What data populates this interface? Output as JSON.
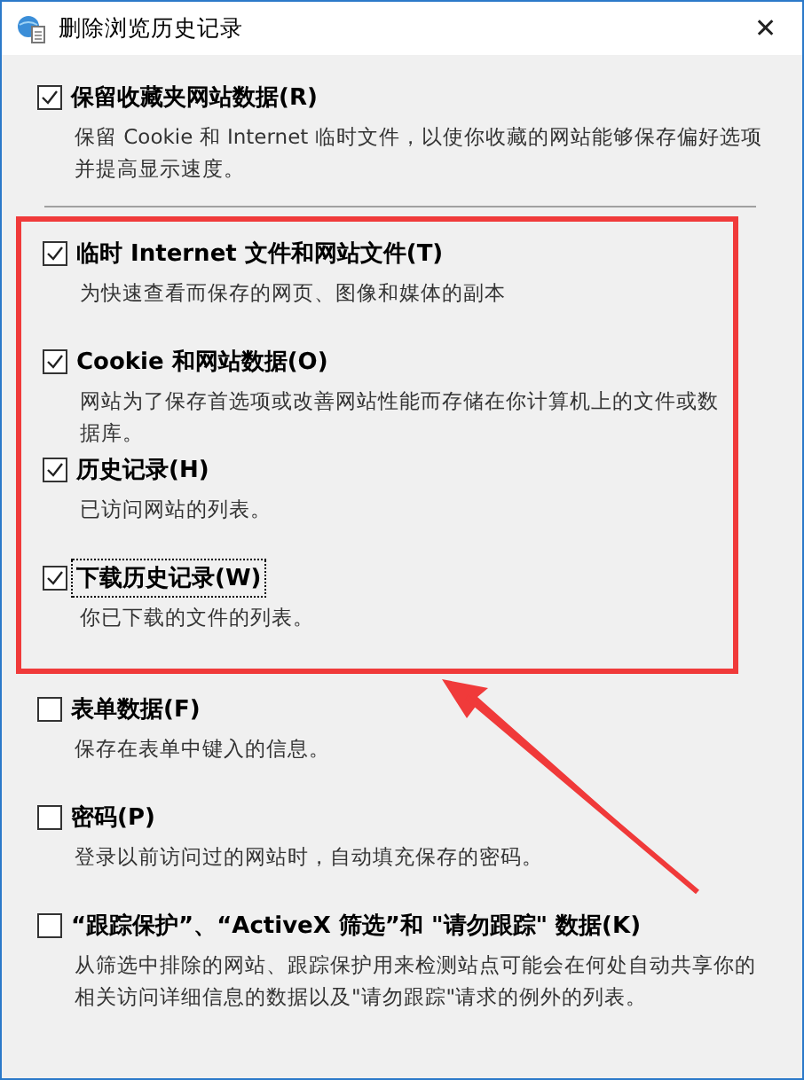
{
  "window": {
    "title": "删除浏览历史记录",
    "close": "✕"
  },
  "options": [
    {
      "label": "保留收藏夹网站数据(R)",
      "description": "保留 Cookie 和 Internet 临时文件，以使你收藏的网站能够保存偏好选项并提高显示速度。",
      "checked": true,
      "focused": false
    },
    {
      "label": "临时 Internet 文件和网站文件(T)",
      "description": "为快速查看而保存的网页、图像和媒体的副本",
      "checked": true,
      "highlighted": true,
      "focused": false
    },
    {
      "label": "Cookie 和网站数据(O)",
      "description": "网站为了保存首选项或改善网站性能而存储在你计算机上的文件或数据库。",
      "checked": true,
      "highlighted": true,
      "focused": false
    },
    {
      "label": "历史记录(H)",
      "description": "已访问网站的列表。",
      "checked": true,
      "highlighted": true,
      "focused": false
    },
    {
      "label": "下载历史记录(W)",
      "description": "你已下载的文件的列表。",
      "checked": true,
      "highlighted": true,
      "focused": true
    },
    {
      "label": "表单数据(F)",
      "description": "保存在表单中键入的信息。",
      "checked": false,
      "highlighted": false,
      "focused": false
    },
    {
      "label": "密码(P)",
      "description": "登录以前访问过的网站时，自动填充保存的密码。",
      "checked": false,
      "highlighted": false,
      "focused": false
    },
    {
      "label": "“跟踪保护”、“ActiveX 筛选”和 \"请勿跟踪\" 数据(K)",
      "description": "从筛选中排除的网站、跟踪保护用来检测站点可能会在何处自动共享你的相关访问详细信息的数据以及\"请勿跟踪\"请求的例外的列表。",
      "checked": false,
      "highlighted": false,
      "focused": false
    }
  ]
}
